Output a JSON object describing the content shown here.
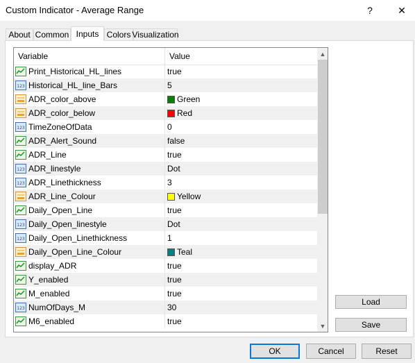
{
  "window": {
    "title": "Custom Indicator - Average Range",
    "help_glyph": "?",
    "close_glyph": "✕"
  },
  "tabs": [
    {
      "label": "About"
    },
    {
      "label": "Common"
    },
    {
      "label": "Inputs",
      "active": true
    },
    {
      "label": "Colors"
    },
    {
      "label": "Visualization"
    }
  ],
  "grid": {
    "headers": {
      "variable": "Variable",
      "value": "Value"
    },
    "rows": [
      {
        "icon": "bool-icon",
        "name": "Print_Historical_HL_lines",
        "value": "true"
      },
      {
        "icon": "int-icon",
        "name": "Historical_HL_line_Bars",
        "value": "5"
      },
      {
        "icon": "color-icon",
        "name": "ADR_color_above",
        "value": "Green",
        "color": "#008000"
      },
      {
        "icon": "color-icon",
        "name": "ADR_color_below",
        "value": "Red",
        "color": "#ff0000"
      },
      {
        "icon": "int-icon",
        "name": "TimeZoneOfData",
        "value": "0"
      },
      {
        "icon": "bool-icon",
        "name": "ADR_Alert_Sound",
        "value": "false"
      },
      {
        "icon": "bool-icon",
        "name": "ADR_Line",
        "value": "true"
      },
      {
        "icon": "int-icon",
        "name": "ADR_linestyle",
        "value": "Dot"
      },
      {
        "icon": "int-icon",
        "name": "ADR_Linethickness",
        "value": "3"
      },
      {
        "icon": "color-icon",
        "name": "ADR_Line_Colour",
        "value": "Yellow",
        "color": "#ffff00"
      },
      {
        "icon": "bool-icon",
        "name": "Daily_Open_Line",
        "value": "true"
      },
      {
        "icon": "int-icon",
        "name": "Daily_Open_linestyle",
        "value": "Dot"
      },
      {
        "icon": "int-icon",
        "name": "Daily_Open_Linethickness",
        "value": "1"
      },
      {
        "icon": "color-icon",
        "name": "Daily_Open_Line_Colour",
        "value": "Teal",
        "color": "#008080"
      },
      {
        "icon": "bool-icon",
        "name": "display_ADR",
        "value": "true"
      },
      {
        "icon": "bool-icon",
        "name": "Y_enabled",
        "value": "true"
      },
      {
        "icon": "bool-icon",
        "name": "M_enabled",
        "value": "true"
      },
      {
        "icon": "int-icon",
        "name": "NumOfDays_M",
        "value": "30"
      },
      {
        "icon": "bool-icon",
        "name": "M6_enabled",
        "value": "true"
      }
    ]
  },
  "scrollbar": {
    "up_glyph": "▲",
    "down_glyph": "▼"
  },
  "side_buttons": {
    "load_label": "Load",
    "save_label": "Save"
  },
  "footer_buttons": {
    "ok_label": "OK",
    "cancel_label": "Cancel",
    "reset_label": "Reset"
  }
}
